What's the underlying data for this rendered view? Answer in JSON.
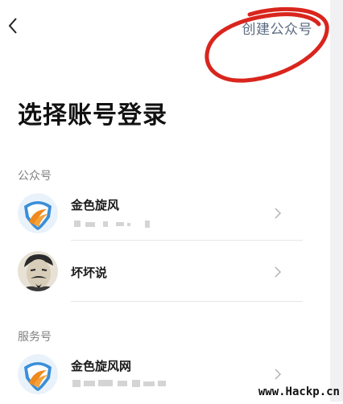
{
  "header": {
    "back_icon": "chevron-left-icon",
    "create_label": "创建公众号"
  },
  "page": {
    "title": "选择账号登录"
  },
  "sections": [
    {
      "label": "公众号",
      "accounts": [
        {
          "name": "金色旋风",
          "avatar": "golden-whirlwind-logo"
        },
        {
          "name": "坏坏说",
          "avatar": "man-with-mustache-portrait"
        }
      ]
    },
    {
      "label": "服务号",
      "accounts": [
        {
          "name": "金色旋风网",
          "avatar": "golden-whirlwind-logo"
        }
      ]
    }
  ],
  "watermark": "www.Hackp.cn",
  "colors": {
    "annotation": "#d9251d",
    "link": "#5a6a80",
    "logo_blue": "#3a8fd8",
    "logo_orange": "#f08a1c"
  }
}
